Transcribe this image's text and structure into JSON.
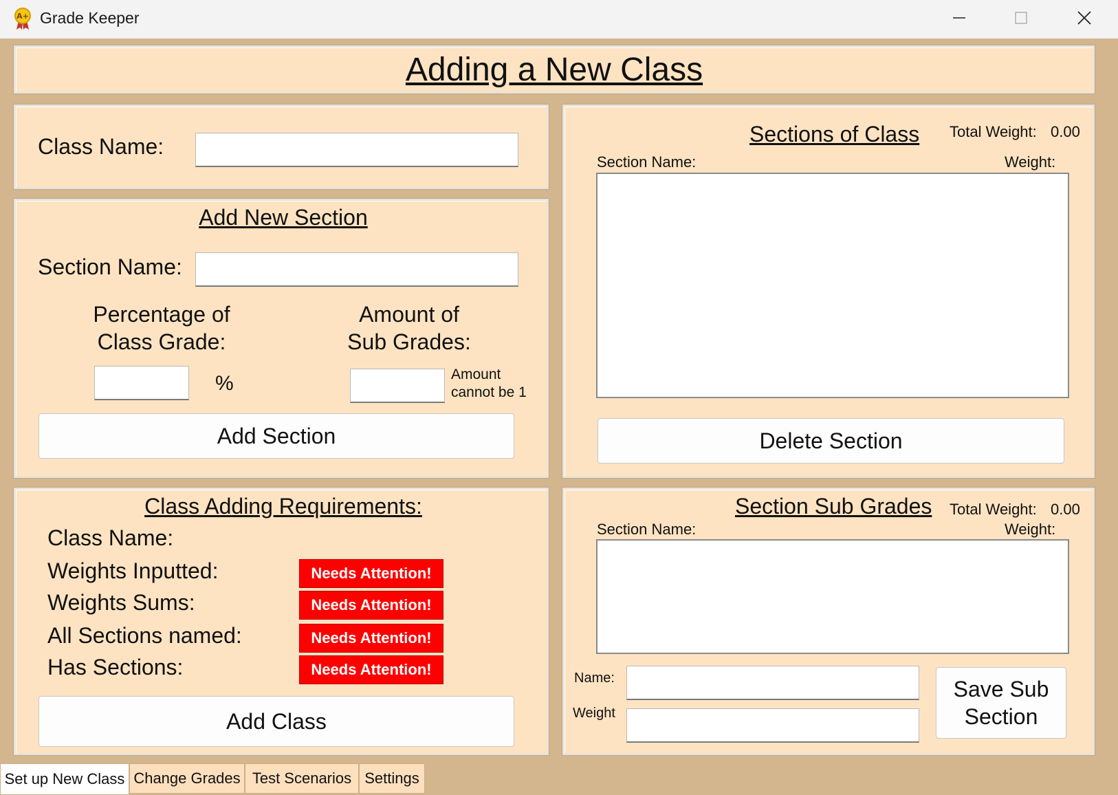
{
  "window": {
    "title": "Grade Keeper",
    "icons": {
      "app": "award-ribbon-icon",
      "minimize": "minimize-icon",
      "maximize": "maximize-icon",
      "close": "close-icon"
    }
  },
  "header": {
    "title": "Adding a New Class"
  },
  "class_name_panel": {
    "label": "Class Name:",
    "value": ""
  },
  "add_section_panel": {
    "heading": "Add New Section",
    "section_name_label": "Section Name:",
    "section_name_value": "",
    "percentage_label_line1": "Percentage of",
    "percentage_label_line2": "Class Grade:",
    "percentage_value": "",
    "percent_symbol": "%",
    "amount_label_line1": "Amount of",
    "amount_label_line2": "Sub Grades:",
    "amount_value": "",
    "amount_warning_line1": "Amount",
    "amount_warning_line2": "cannot be 1",
    "add_button": "Add Section"
  },
  "sections_panel": {
    "heading": "Sections of Class",
    "total_weight_label": "Total Weight:",
    "total_weight_value": "0.00",
    "col_section_name": "Section Name:",
    "col_weight": "Weight:",
    "items": [],
    "delete_button": "Delete Section"
  },
  "requirements_panel": {
    "heading": "Class Adding Requirements:",
    "items": [
      {
        "label": "Class Name:",
        "status": ""
      },
      {
        "label": "Weights Inputted:",
        "status": "Needs Attention!"
      },
      {
        "label": "Weights Sums:",
        "status": "Needs Attention!"
      },
      {
        "label": "All Sections named:",
        "status": "Needs Attention!"
      },
      {
        "label": "Has Sections:",
        "status": "Needs Attention!"
      }
    ],
    "status_color": "#ff0000",
    "add_button": "Add Class"
  },
  "sub_grades_panel": {
    "heading": "Section Sub Grades",
    "total_weight_label": "Total Weight:",
    "total_weight_value": "0.00",
    "col_section_name": "Section Name:",
    "col_weight": "Weight:",
    "items": [],
    "name_label": "Name:",
    "name_value": "",
    "weight_label": "Weight",
    "weight_value": "",
    "save_button_line1": "Save Sub",
    "save_button_line2": "Section"
  },
  "tabs": [
    {
      "label": "Set up New Class",
      "active": true
    },
    {
      "label": "Change Grades",
      "active": false
    },
    {
      "label": "Test Scenarios",
      "active": false
    },
    {
      "label": "Settings",
      "active": false
    }
  ],
  "colors": {
    "panel": "#fde3c2",
    "background": "#d3b58e",
    "alert": "#ff0000"
  }
}
